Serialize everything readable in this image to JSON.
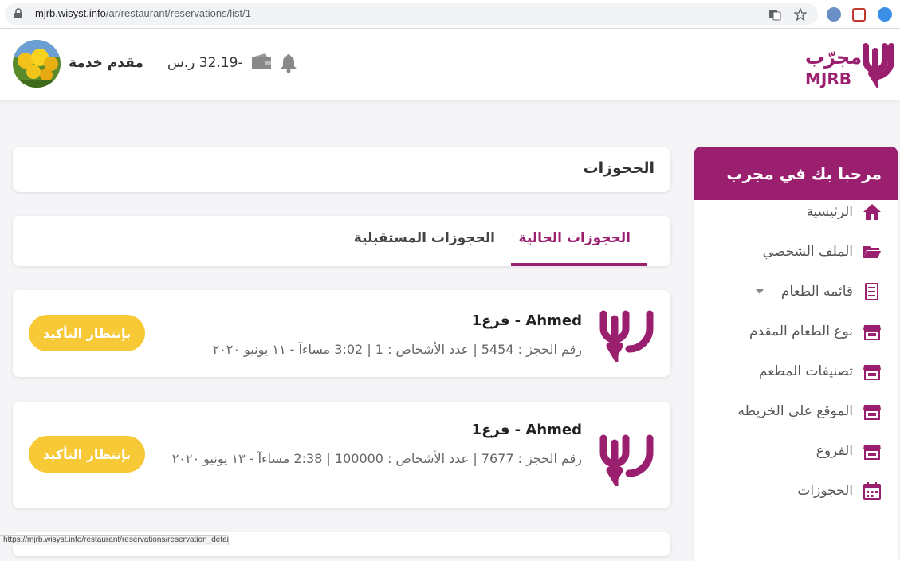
{
  "browser": {
    "url_domain": "mjrb.wisyst.info",
    "url_path": "/ar/restaurant/reservations/list/1"
  },
  "header": {
    "logo_alt": "مجرّب MJRB",
    "user_name": "مقدم خدمة",
    "balance": "-32.19 ر.س"
  },
  "sidebar": {
    "welcome": "مرحبا بك في مجرب",
    "items": [
      {
        "label": "الرئيسية",
        "icon": "home-icon"
      },
      {
        "label": "الملف الشخصي",
        "icon": "folder-icon"
      },
      {
        "label": "قائمه الطعام",
        "icon": "menu-list-icon"
      },
      {
        "label": "نوع الطعام المقدم",
        "icon": "store-icon"
      },
      {
        "label": "تصنيفات المطعم",
        "icon": "store-icon"
      },
      {
        "label": "الموقع علي الخريطه",
        "icon": "store-icon"
      },
      {
        "label": "الفروع",
        "icon": "store-icon"
      },
      {
        "label": "الحجوزات",
        "icon": "calendar-icon"
      }
    ]
  },
  "main": {
    "page_title": "الحجوزات",
    "tabs": [
      {
        "label": "الحجوزات الحالية",
        "active": true
      },
      {
        "label": "الحجوزات المستقبلية",
        "active": false
      }
    ],
    "reservations": [
      {
        "title": "Ahmed - فرع1",
        "details": "رقم الحجز : 5454 | عدد الأشخاص : 1 | 3:02 مساءآ - ١١ يونيو ٢٠٢٠",
        "status": "بإنتظار التأكيد"
      },
      {
        "title": "Ahmed - فرع1",
        "details": "رقم الحجز : 7677 | عدد الأشخاص : 100000 | 2:38 مساءآ - ١٣ يونيو ٢٠٢٠",
        "status": "بإنتظار التأكيد"
      }
    ]
  },
  "statusbar": {
    "link": "https://mjrb.wisyst.info/restaurant/reservations/reservation_details/283"
  },
  "colors": {
    "brand": "#9a1f6e",
    "pending": "#f7c936"
  }
}
